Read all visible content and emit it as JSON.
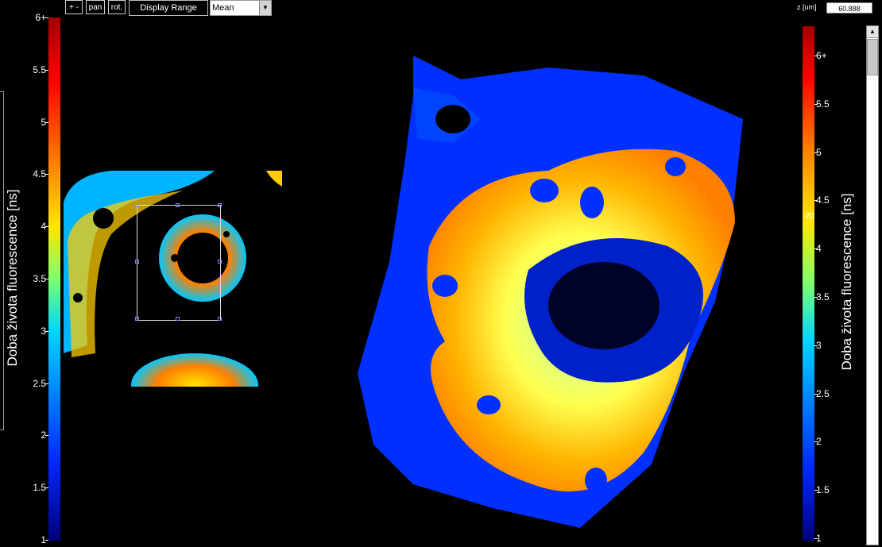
{
  "toolbar": {
    "zoom_label": "+ -",
    "pan_label": "pan",
    "rot_label": "rot.",
    "display_range_label": "Display Range",
    "mode_select_value": "Mean"
  },
  "zslice": {
    "label": "z [um]",
    "value": "60.888"
  },
  "left_colorbar": {
    "title": "Doba života fluorescence [ns]",
    "ticks": [
      "6+",
      "5.5",
      "5",
      "4.5",
      "4",
      "3.5",
      "3",
      "2.5",
      "2",
      "1.5",
      "1"
    ]
  },
  "right_colorbar": {
    "title": "Doba života fluorescence [ns]",
    "ticks": [
      "6+",
      "5.5",
      "5",
      "4.5",
      "4",
      "3.5",
      "3",
      "2.5",
      "2",
      "1.5",
      "1"
    ]
  },
  "stray_label": "20",
  "colors": {
    "background": "#000000",
    "low": "#0028ff",
    "mid": "#7dff6e",
    "high": "#ff0000"
  },
  "icons": {
    "dropdown": "chevron-down-icon",
    "scroll_up": "chevron-up-icon"
  }
}
